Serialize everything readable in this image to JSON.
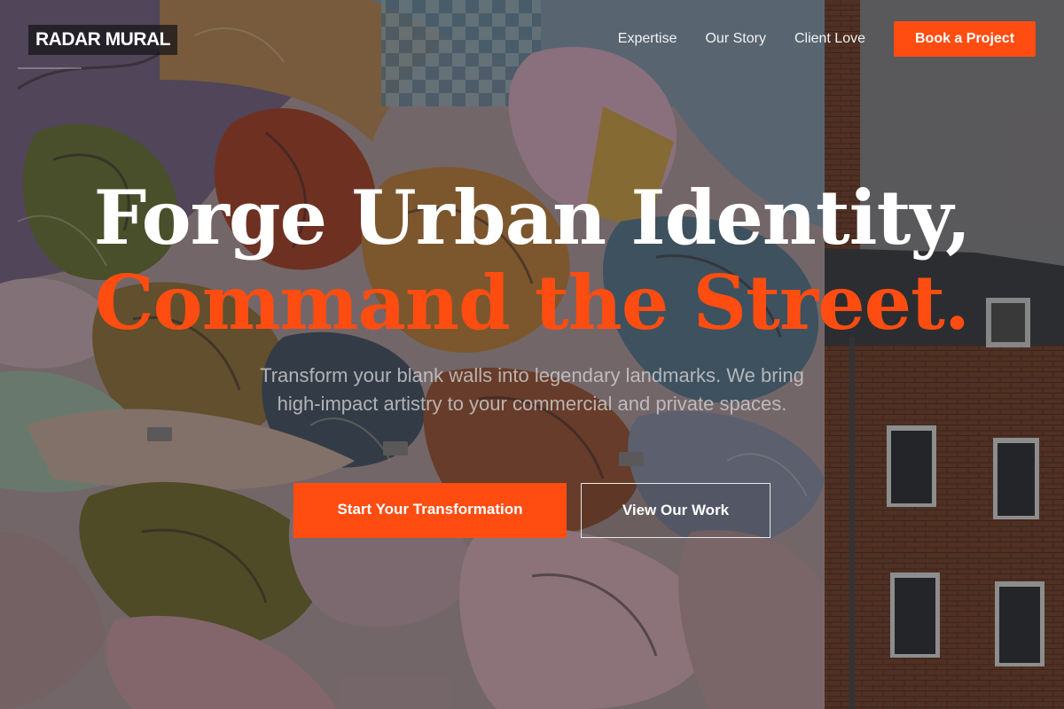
{
  "brand": {
    "logo_text": "RADAR MURAL",
    "accent_color": "#ff4d12"
  },
  "nav": {
    "links": [
      "Expertise",
      "Our Story",
      "Client Love"
    ],
    "cta_label": "Book a Project"
  },
  "hero": {
    "headline_line1": "Forge Urban Identity,",
    "headline_line2": "Command the Street.",
    "subtitle": "Transform your blank walls into legendary landmarks. We bring high-impact artistry to your commercial and private spaces.",
    "primary_cta": "Start Your Transformation",
    "secondary_cta": "View Our Work"
  }
}
